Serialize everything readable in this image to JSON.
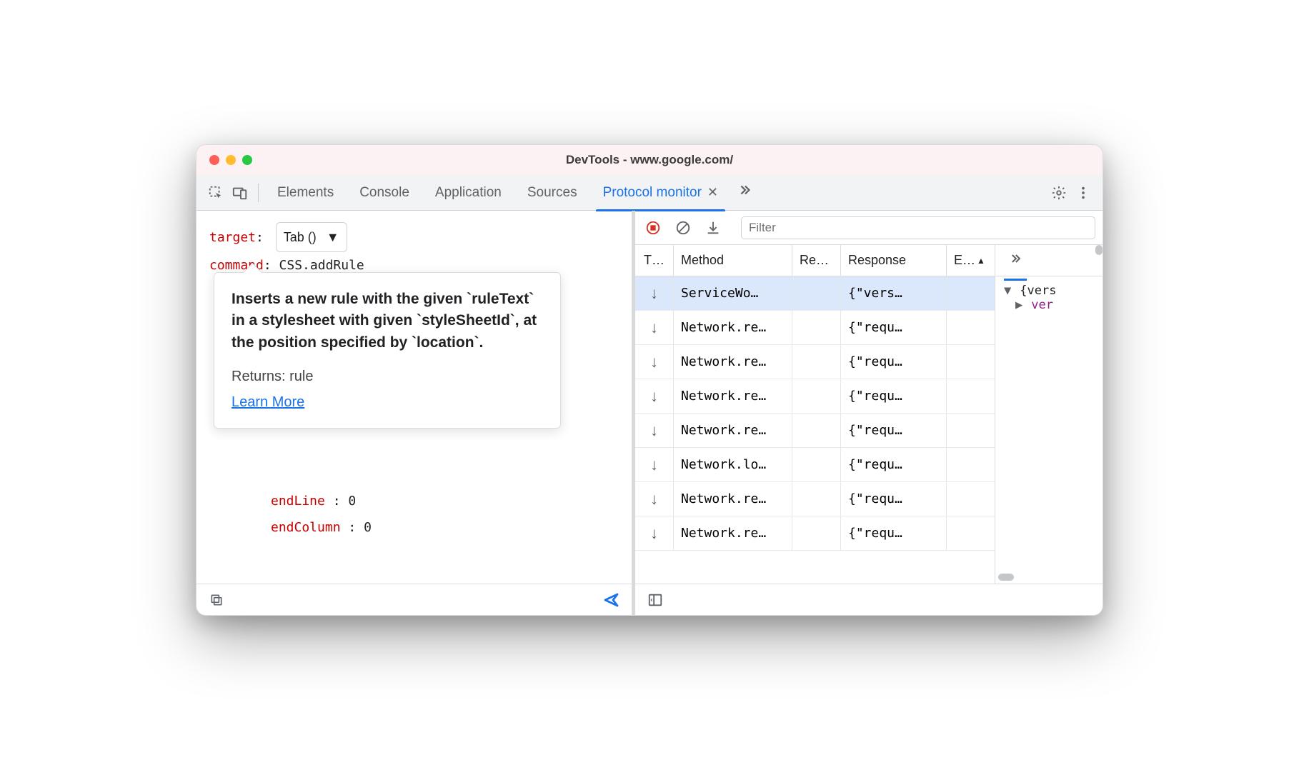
{
  "window": {
    "title": "DevTools - www.google.com/"
  },
  "tabs": {
    "items": [
      "Elements",
      "Console",
      "Application",
      "Sources",
      "Protocol monitor"
    ],
    "activeIndex": 4
  },
  "editor": {
    "targetLabel": "target",
    "targetValue": "Tab ()",
    "commandLabel": "command",
    "commandValue": "CSS.addRule",
    "params": [
      {
        "name": "endLine",
        "value": "0"
      },
      {
        "name": "endColumn",
        "value": "0"
      }
    ]
  },
  "tooltip": {
    "description": "Inserts a new rule with the given `ruleText` in a stylesheet with given `styleSheetId`, at the position specified by `location`.",
    "returns": "Returns: rule",
    "link": "Learn More"
  },
  "filter": {
    "placeholder": "Filter"
  },
  "table": {
    "headers": {
      "type": "T…",
      "method": "Method",
      "re": "Re…",
      "response": "Response",
      "e": "E…"
    },
    "rows": [
      {
        "dir": "↓",
        "method": "ServiceWo…",
        "re": "",
        "response": "{\"vers…",
        "e": ""
      },
      {
        "dir": "↓",
        "method": "Network.re…",
        "re": "",
        "response": "{\"requ…",
        "e": ""
      },
      {
        "dir": "↓",
        "method": "Network.re…",
        "re": "",
        "response": "{\"requ…",
        "e": ""
      },
      {
        "dir": "↓",
        "method": "Network.re…",
        "re": "",
        "response": "{\"requ…",
        "e": ""
      },
      {
        "dir": "↓",
        "method": "Network.re…",
        "re": "",
        "response": "{\"requ…",
        "e": ""
      },
      {
        "dir": "↓",
        "method": "Network.lo…",
        "re": "",
        "response": "{\"requ…",
        "e": ""
      },
      {
        "dir": "↓",
        "method": "Network.re…",
        "re": "",
        "response": "{\"requ…",
        "e": ""
      },
      {
        "dir": "↓",
        "method": "Network.re…",
        "re": "",
        "response": "{\"requ…",
        "e": ""
      }
    ]
  },
  "inspector": {
    "line1": "{vers",
    "line2prop": "ver"
  }
}
